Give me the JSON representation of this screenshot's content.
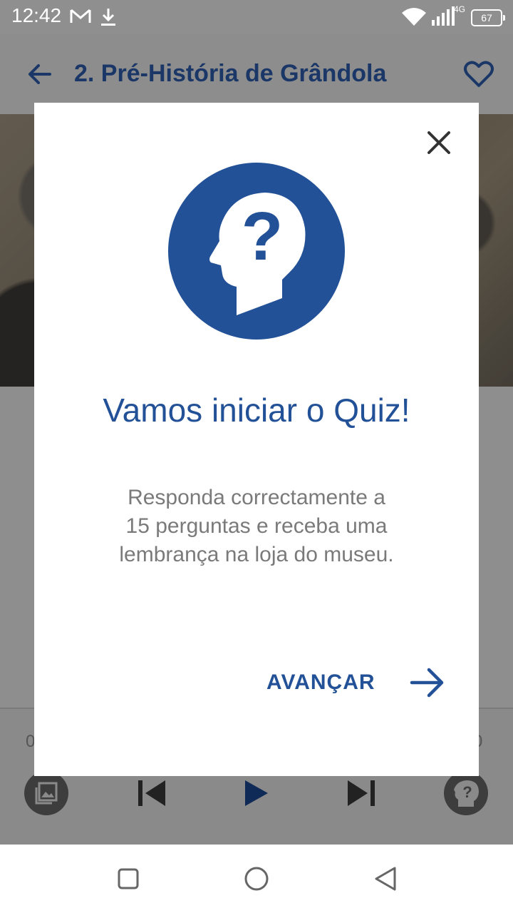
{
  "status_bar": {
    "time": "12:42",
    "icons": [
      "gmail-icon",
      "download-icon",
      "wifi-icon",
      "signal-icon"
    ],
    "network": "4G",
    "battery": "67"
  },
  "app_bar": {
    "title": "2. Pré-História de Grândola",
    "icons": [
      "back-arrow-icon",
      "heart-icon"
    ]
  },
  "player": {
    "time_left": "0",
    "time_right": "0",
    "icons": [
      "gallery-icon",
      "skip-previous-icon",
      "play-icon",
      "skip-next-icon",
      "quiz-head-icon"
    ]
  },
  "dialog": {
    "title": "Vamos iniciar o Quiz!",
    "body_lines": [
      "Responda correctamente a",
      "15 perguntas e receba uma",
      "lembrança na loja do museu."
    ],
    "next_label": "AVANÇAR",
    "icons": [
      "close-icon",
      "quiz-head-icon",
      "arrow-right-icon"
    ]
  },
  "nav_bar": {
    "icons": [
      "recents-square-icon",
      "home-circle-icon",
      "back-triangle-icon"
    ]
  },
  "colors": {
    "accent": "#225197",
    "title_dark": "#1a3767",
    "scrim": "#8e8e8e",
    "body_text": "#7a7a7a"
  }
}
